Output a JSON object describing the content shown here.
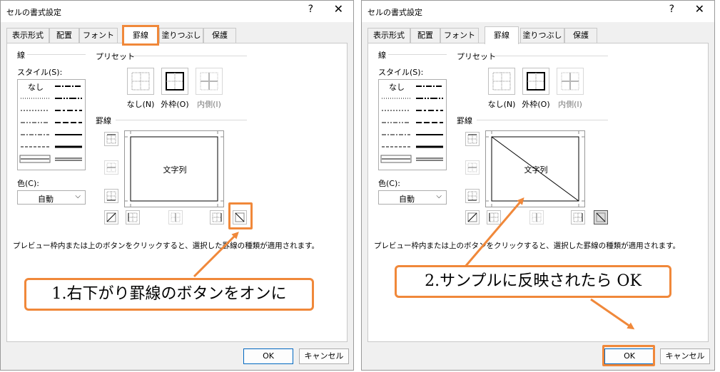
{
  "dialog": {
    "title": "セルの書式設定",
    "help_glyph": "?",
    "close_glyph": "✕",
    "tabs": [
      "表示形式",
      "配置",
      "フォント",
      "罫線",
      "塗りつぶし",
      "保護"
    ],
    "line_label": "線",
    "style_label": "スタイル(S):",
    "none_style": "なし",
    "color_label": "色(C):",
    "color_value": "自動",
    "presets_label": "プリセット",
    "preset_none": "なし(N)",
    "preset_outline": "外枠(O)",
    "preset_inside": "内側(I)",
    "border_label": "罫線",
    "preview_text": "文字列",
    "note": "プレビュー枠内または上のボタンをクリックすると、選択した罫線の種類が適用されます。",
    "ok": "OK",
    "cancel": "キャンセル"
  },
  "callouts": {
    "step1": "1.右下がり罫線のボタンをオンに",
    "step2": "2.サンプルに反映されたら OK"
  },
  "colors": {
    "highlight": "#f0883a",
    "dialog_bg": "#f0f0f0",
    "ok_border": "#0067c0"
  }
}
